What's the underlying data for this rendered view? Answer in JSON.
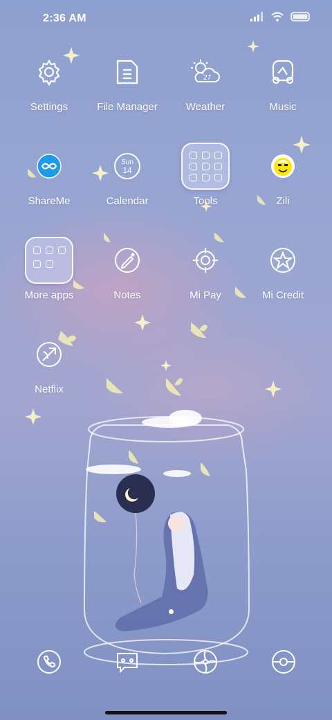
{
  "status_bar": {
    "time": "2:36 AM",
    "battery": "battery-icon"
  },
  "apps": [
    {
      "label": "Settings",
      "icon": "gear-icon"
    },
    {
      "label": "File Manager",
      "icon": "folder-file-icon"
    },
    {
      "label": "Weather",
      "icon": "weather-cloud-sun-icon",
      "temp": "27"
    },
    {
      "label": "Music",
      "icon": "music-note-icon"
    },
    {
      "label": "ShareMe",
      "icon": "shareme-infinity-icon"
    },
    {
      "label": "Calendar",
      "icon": "calendar-icon",
      "day": "Sun",
      "date": "14"
    },
    {
      "label": "Tools",
      "icon": "tools-folder-icon"
    },
    {
      "label": "Zili",
      "icon": "zili-smiley-icon"
    },
    {
      "label": "More apps",
      "icon": "more-apps-folder-icon"
    },
    {
      "label": "Notes",
      "icon": "notes-pen-icon"
    },
    {
      "label": "Mi Pay",
      "icon": "crosshair-pay-icon"
    },
    {
      "label": "Mi Credit",
      "icon": "star-credit-icon"
    },
    {
      "label": "Netflix",
      "icon": "netflix-icon"
    }
  ],
  "dock": [
    {
      "name": "phone",
      "icon": "phone-icon"
    },
    {
      "name": "messages",
      "icon": "message-icon"
    },
    {
      "name": "browser",
      "icon": "browser-aperture-icon"
    },
    {
      "name": "camera",
      "icon": "camera-lens-icon"
    }
  ],
  "colors": {
    "sky_top": "#8ea0cf",
    "sky_bottom": "#7f90c3",
    "cloud_pink": "#dca0b9",
    "shareme_blue": "#1e9be8",
    "zili_yellow": "#ffe600"
  }
}
